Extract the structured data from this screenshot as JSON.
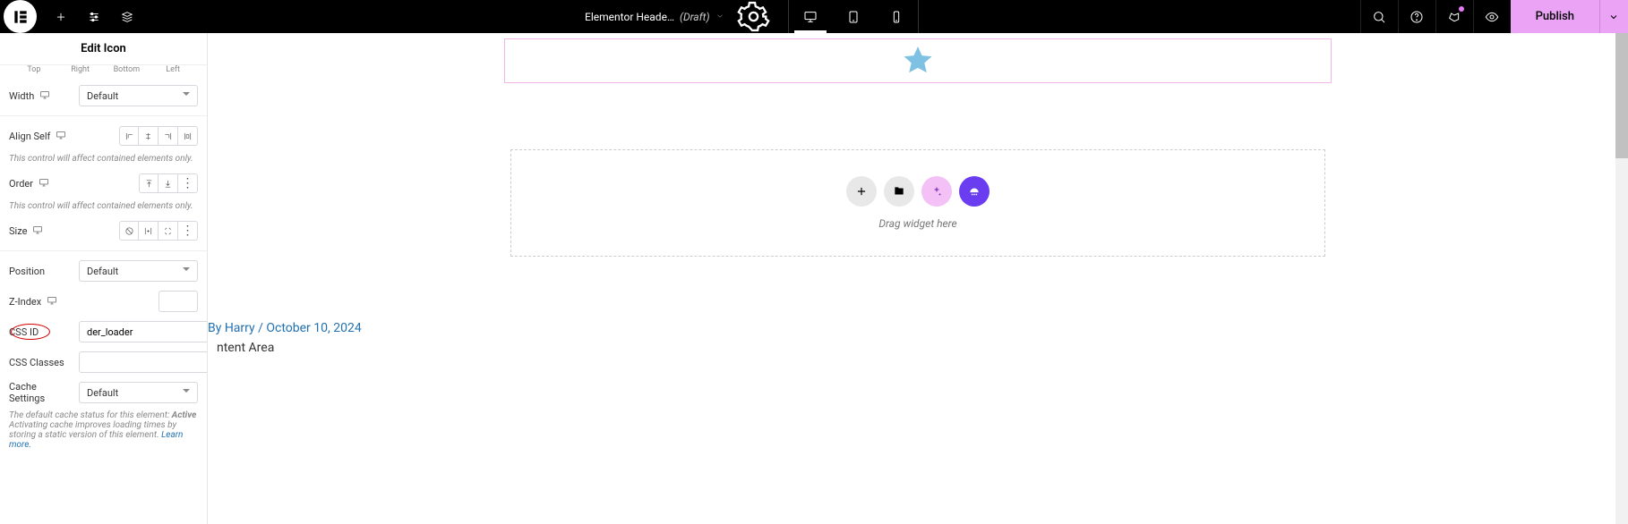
{
  "topbar": {
    "doc_title": "Elementor Heade…",
    "doc_status": "(Draft)",
    "publish_label": "Publish"
  },
  "panel": {
    "title": "Edit Icon",
    "spacing_labels": {
      "top": "Top",
      "right": "Right",
      "bottom": "Bottom",
      "left": "Left"
    },
    "width_label": "Width",
    "width_value": "Default",
    "align_self_label": "Align Self",
    "align_help": "This control will affect contained elements only.",
    "order_label": "Order",
    "order_help": "This control will affect contained elements only.",
    "size_label": "Size",
    "position_label": "Position",
    "position_value": "Default",
    "zindex_label": "Z-Index",
    "zindex_value": "",
    "cssid_label": "CSS ID",
    "cssid_value": "der_loader",
    "cssclasses_label": "CSS Classes",
    "cssclasses_value": "",
    "cache_label": "Cache Settings",
    "cache_value": "Default",
    "cache_help_a": "The default cache status for this element: ",
    "cache_help_b": "Active",
    "cache_help_c": "Activating cache improves loading times by storing a static version of this element. ",
    "cache_help_link": "Learn more."
  },
  "canvas": {
    "byline": "By Harry / October 10, 2024",
    "content_area": "ntent Area",
    "drop_text": "Drag widget here"
  }
}
